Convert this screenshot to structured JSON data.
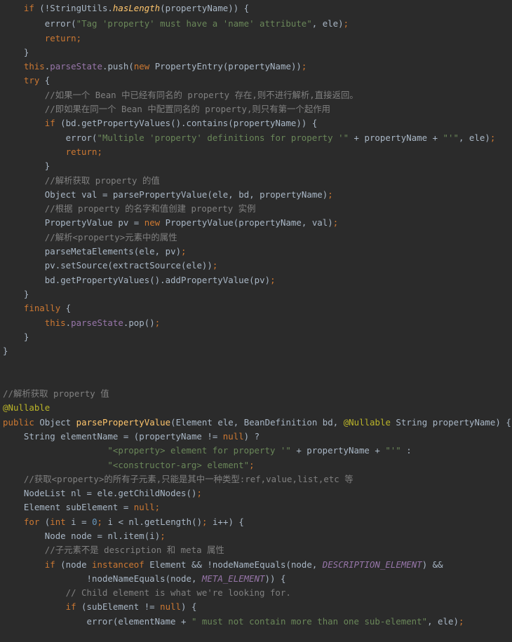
{
  "editor": {
    "theme": "darcula",
    "background": "#2b2b2b",
    "default_text_color": "#a9b7c6",
    "colors": {
      "keyword": "#cc7832",
      "string": "#6a8759",
      "comment": "#808080",
      "number": "#6897bb",
      "annotation": "#bbb529",
      "method": "#ffc66d",
      "constant": "#9876aa",
      "field": "#9876aa"
    },
    "language": "java",
    "lines": [
      "    if (!StringUtils.hasLength(propertyName)) {",
      "        error(\"Tag 'property' must have a 'name' attribute\", ele);",
      "        return;",
      "    }",
      "    this.parseState.push(new PropertyEntry(propertyName));",
      "    try {",
      "        //如果一个 Bean 中已经有同名的 property 存在,则不进行解析,直接返回。",
      "        //即如果在同一个 Bean 中配置同名的 property,则只有第一个起作用",
      "        if (bd.getPropertyValues().contains(propertyName)) {",
      "            error(\"Multiple 'property' definitions for property '\" + propertyName + \"'\", ele);",
      "            return;",
      "        }",
      "        //解析获取 property 的值",
      "        Object val = parsePropertyValue(ele, bd, propertyName);",
      "        //根据 property 的名字和值创建 property 实例",
      "        PropertyValue pv = new PropertyValue(propertyName, val);",
      "        //解析<property>元素中的属性",
      "        parseMetaElements(ele, pv);",
      "        pv.setSource(extractSource(ele));",
      "        bd.getPropertyValues().addPropertyValue(pv);",
      "    }",
      "    finally {",
      "        this.parseState.pop();",
      "    }",
      "}",
      "",
      "",
      "//解析获取 property 值",
      "@Nullable",
      "public Object parsePropertyValue(Element ele, BeanDefinition bd, @Nullable String propertyName) {",
      "    String elementName = (propertyName != null) ?",
      "                    \"<property> element for property '\" + propertyName + \"'\" :",
      "                    \"<constructor-arg> element\";",
      "    //获取<property>的所有子元素,只能是其中一种类型:ref,value,list,etc 等",
      "    NodeList nl = ele.getChildNodes();",
      "    Element subElement = null;",
      "    for (int i = 0; i < nl.getLength(); i++) {",
      "        Node node = nl.item(i);",
      "        //子元素不是 description 和 meta 属性",
      "        if (node instanceof Element && !nodeNameEquals(node, DESCRIPTION_ELEMENT) &&",
      "                !nodeNameEquals(node, META_ELEMENT)) {",
      "            // Child element is what we're looking for.",
      "            if (subElement != null) {",
      "                error(elementName + \" must not contain more than one sub-element\", ele);"
    ]
  }
}
